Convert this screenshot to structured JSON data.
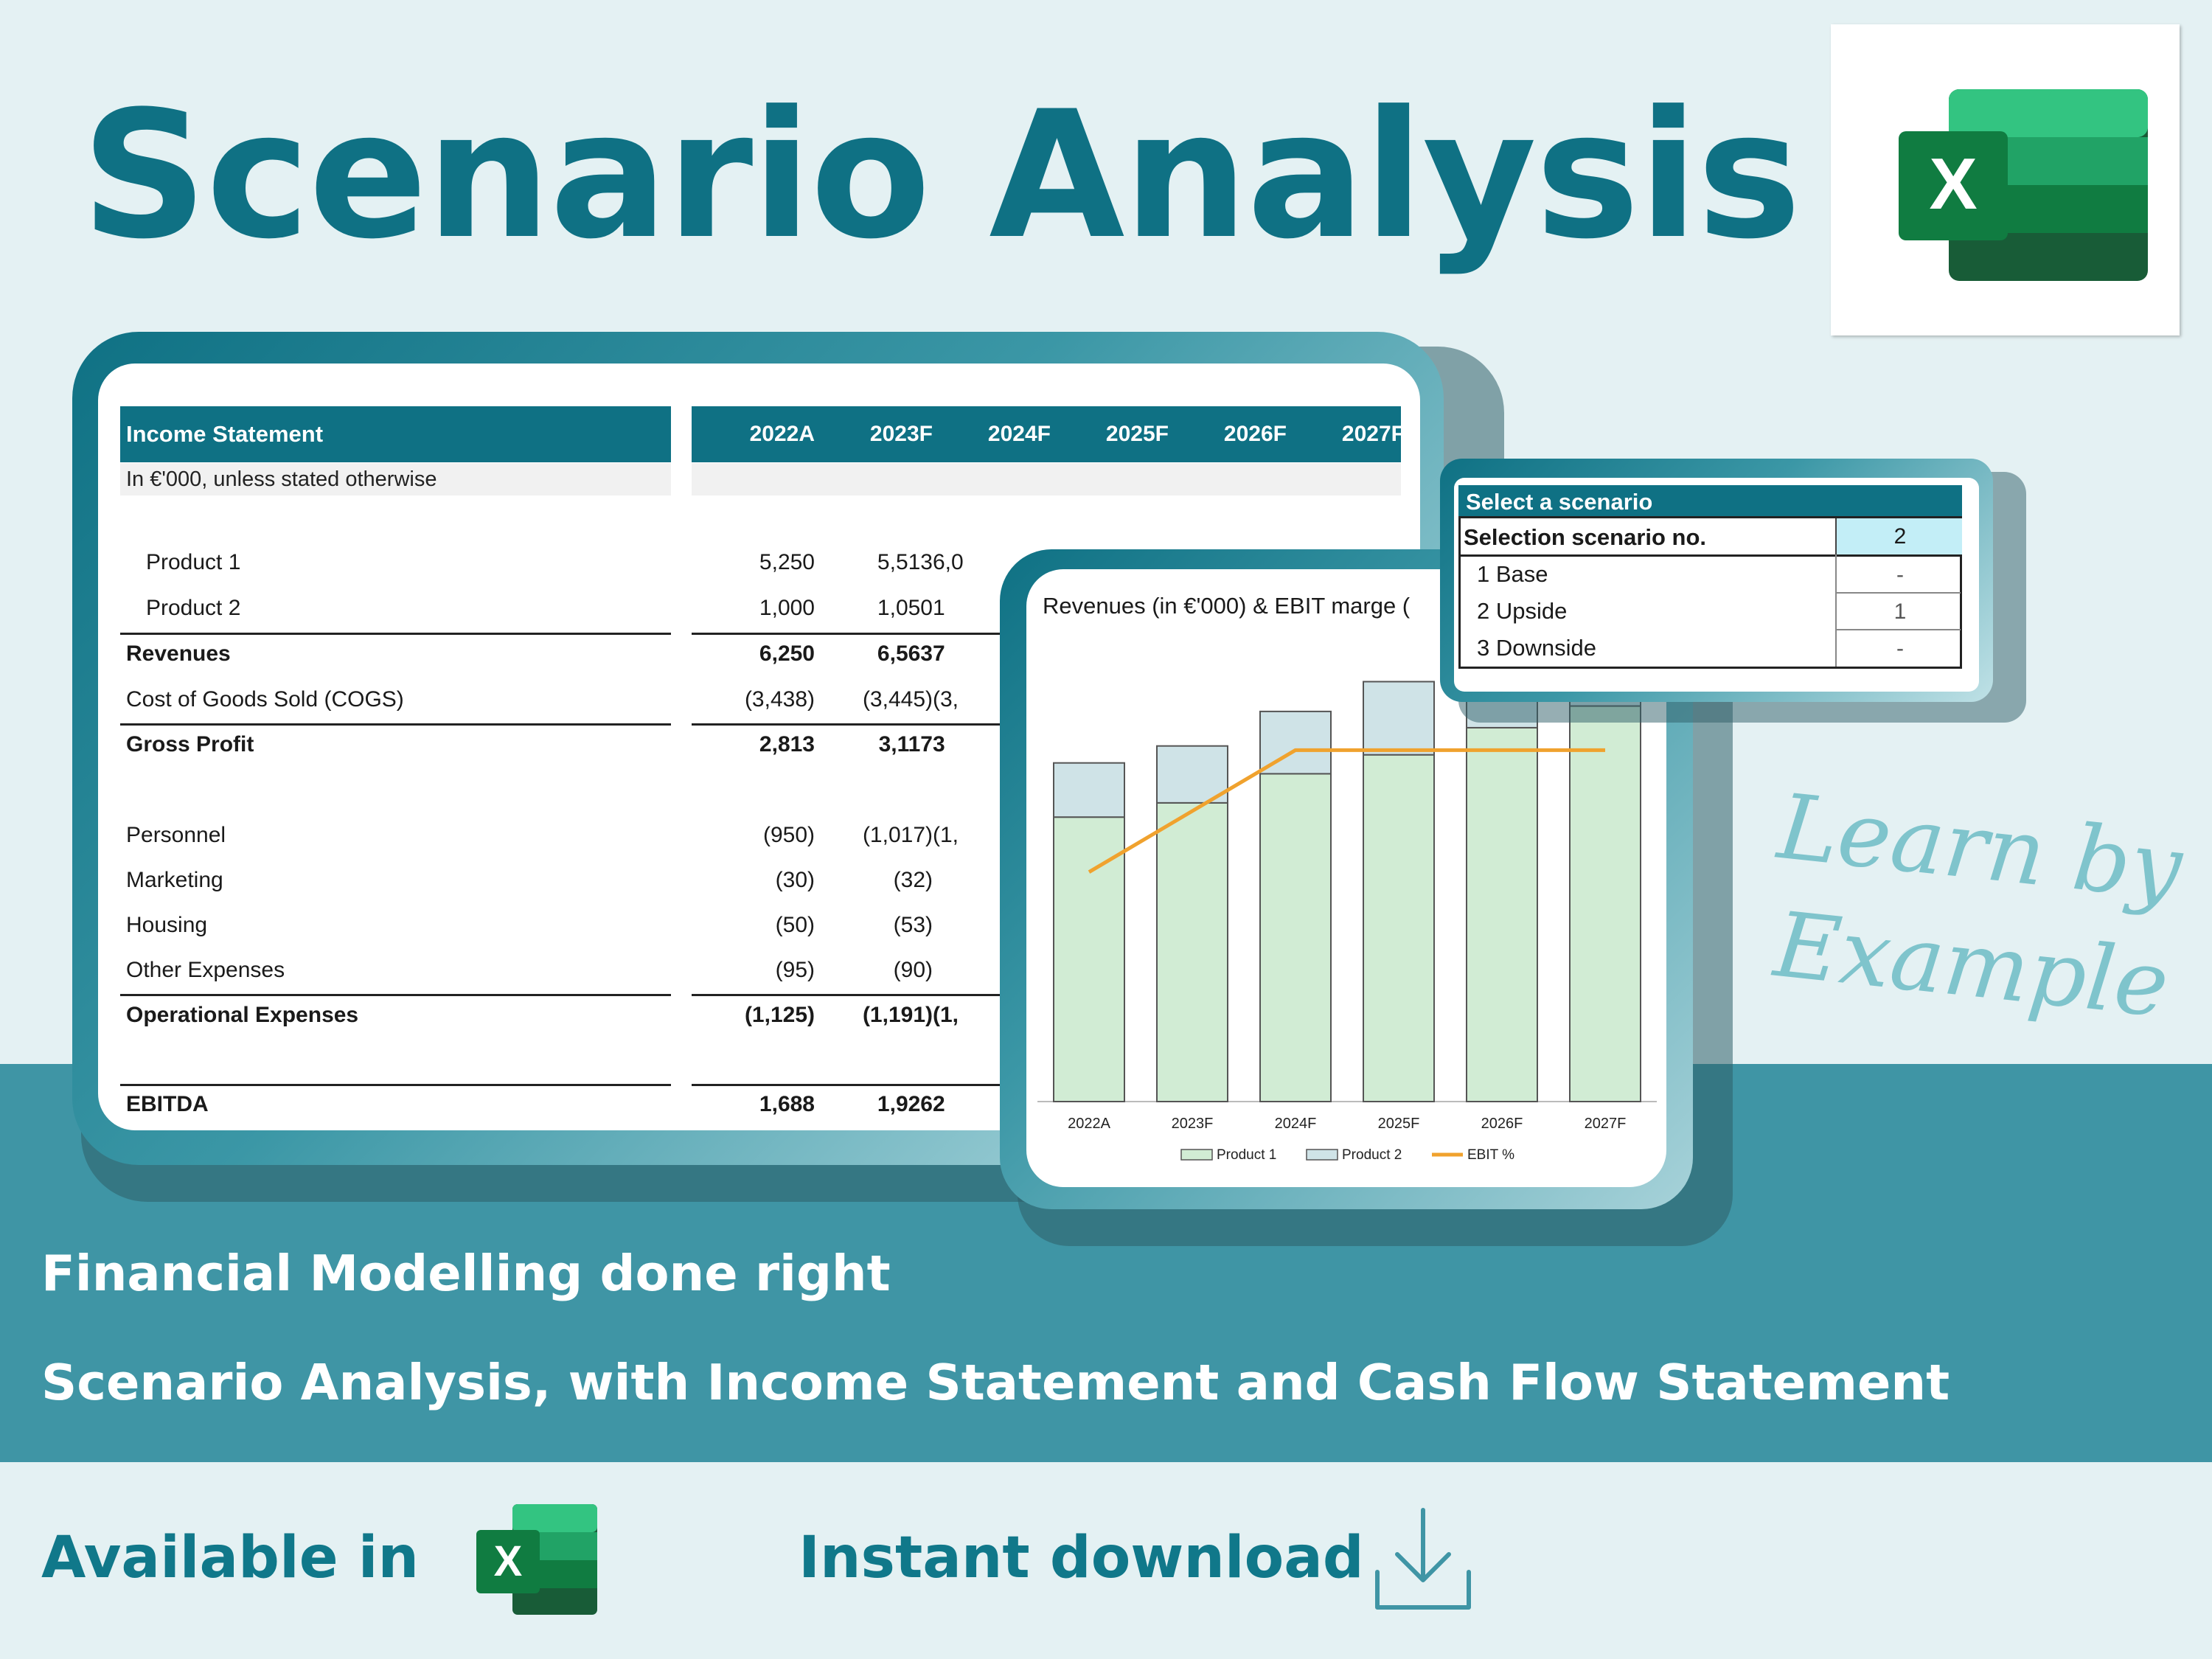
{
  "header": {
    "title": "Scenario Analysis"
  },
  "brand": {
    "accent": "#0f7184",
    "band": "#3f95a5",
    "background": "#e4f1f3"
  },
  "script_text": {
    "line1": "Learn by",
    "line2": "Example"
  },
  "income_statement": {
    "title": "Income Statement",
    "subtitle": "In €'000, unless stated otherwise",
    "years": [
      "2022A",
      "2023F",
      "2024F",
      "2025F",
      "2026F",
      "2027F"
    ],
    "rows": [
      {
        "label": "Product 1",
        "values": [
          "5,250",
          "5,513",
          "6,0"
        ]
      },
      {
        "label": "Product 2",
        "values": [
          "1,000",
          "1,050",
          "1"
        ]
      },
      {
        "label": "Revenues",
        "values": [
          "6,250",
          "6,563",
          "7"
        ]
      },
      {
        "label": "Cost of Goods Sold (COGS)",
        "values": [
          "(3,438)",
          "(3,445)",
          "(3,"
        ]
      },
      {
        "label": "Gross Profit",
        "values": [
          "2,813",
          "3,117",
          "3"
        ]
      },
      {
        "label": "Personnel",
        "values": [
          "(950)",
          "(1,017)",
          "(1,"
        ]
      },
      {
        "label": "Marketing",
        "values": [
          "(30)",
          "(32)",
          ""
        ]
      },
      {
        "label": "Housing",
        "values": [
          "(50)",
          "(53)",
          ""
        ]
      },
      {
        "label": "Other Expenses",
        "values": [
          "(95)",
          "(90)",
          ""
        ]
      },
      {
        "label": "Operational Expenses",
        "values": [
          "(1,125)",
          "(1,191)",
          "(1,"
        ]
      },
      {
        "label": "EBITDA",
        "values": [
          "1,688",
          "1,926",
          "2"
        ]
      }
    ]
  },
  "scenario_selector": {
    "header": "Select a scenario",
    "selection_label": "Selection scenario no.",
    "selection_value": "2",
    "options": [
      {
        "label": "1 Base",
        "flag": "-"
      },
      {
        "label": "2 Upside",
        "flag": "1"
      },
      {
        "label": "3 Downside",
        "flag": "-"
      }
    ]
  },
  "chart_data": {
    "type": "bar",
    "title": "Revenues (in €'000) & EBIT marge (",
    "categories": [
      "2022A",
      "2023F",
      "2024F",
      "2025F",
      "2026F",
      "2027F"
    ],
    "series": [
      {
        "name": "Product 1",
        "type": "stacked-bar",
        "color": "#d1ecd4",
        "values": [
          5250,
          5513,
          6050,
          6400,
          6900,
          7300
        ]
      },
      {
        "name": "Product 2",
        "type": "stacked-bar",
        "color": "#cfe3e7",
        "values": [
          1000,
          1050,
          1150,
          1350,
          1450,
          1550
        ]
      },
      {
        "name": "EBIT %",
        "type": "line",
        "color": "#f0a22e",
        "values": [
          0.14,
          0.18,
          0.22,
          0.22,
          0.22,
          0.22
        ]
      }
    ],
    "ylim": [
      0,
      8600
    ],
    "grid": false,
    "legend": "bottom"
  },
  "taglines": {
    "line1": "Financial Modelling done right",
    "line2": "Scenario Analysis, with Income Statement and Cash Flow Statement"
  },
  "footer": {
    "available": "Available in",
    "download": "Instant download"
  },
  "icons": {
    "excel": "excel-icon",
    "download": "download-icon"
  }
}
